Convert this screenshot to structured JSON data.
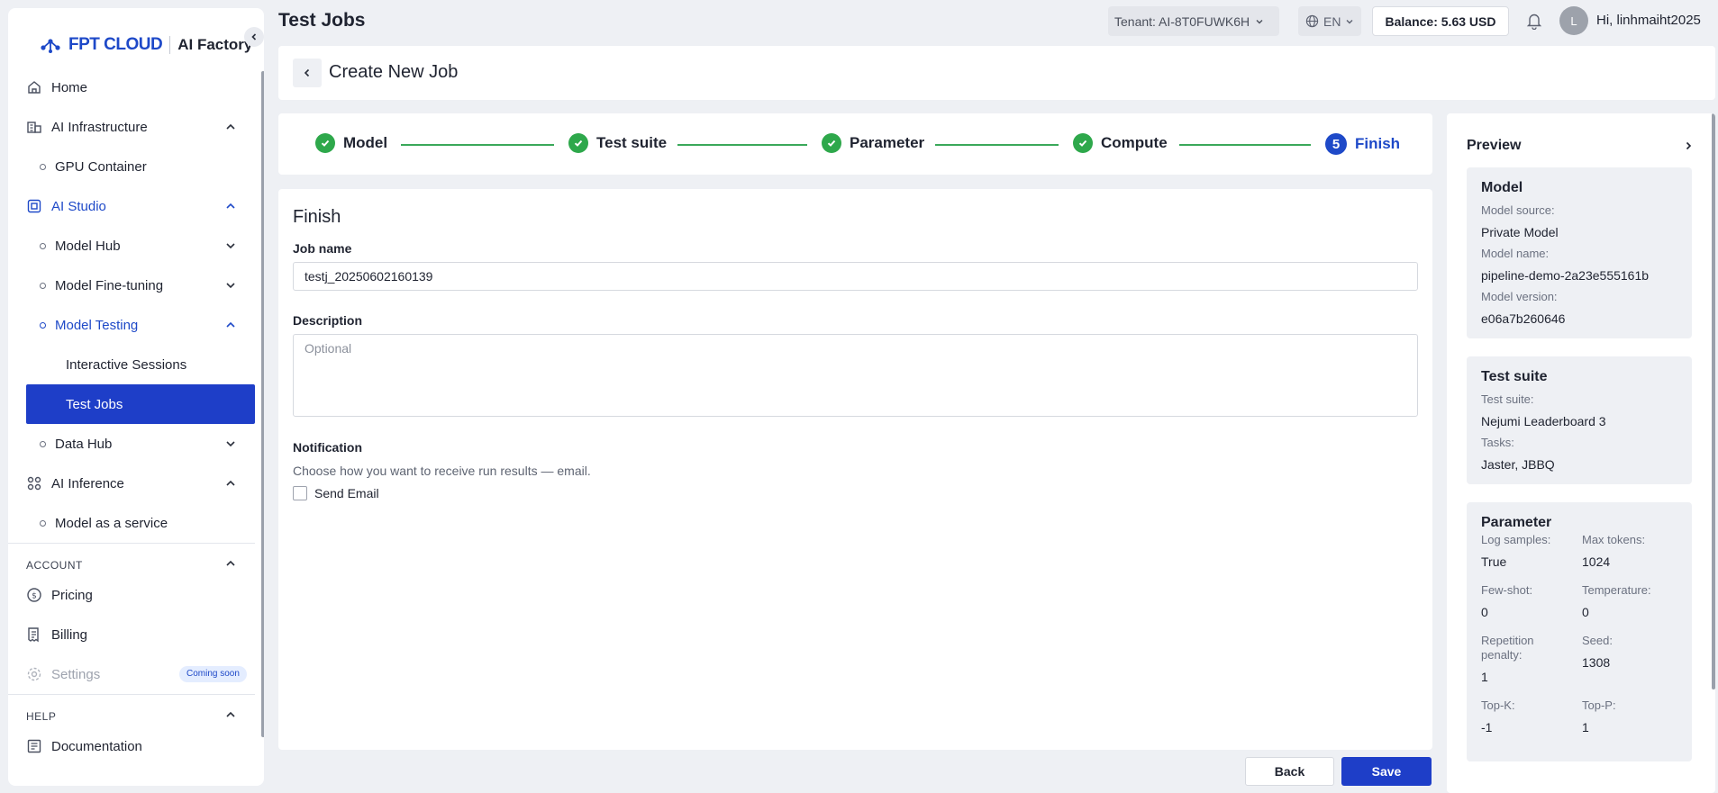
{
  "sidebar": {
    "brand_name": "FPT CLOUD",
    "brand_product": "AI Factory",
    "items": [
      {
        "label": "Home"
      },
      {
        "label": "AI Infrastructure"
      },
      {
        "label": "GPU Container"
      },
      {
        "label": "AI Studio"
      },
      {
        "label": "Model Hub"
      },
      {
        "label": "Model Fine-tuning"
      },
      {
        "label": "Model Testing"
      },
      {
        "label": "Interactive Sessions"
      },
      {
        "label": "Test Jobs"
      },
      {
        "label": "Data Hub"
      },
      {
        "label": "AI Inference"
      },
      {
        "label": "Model as a service"
      }
    ],
    "account_header": "ACCOUNT",
    "account_items": [
      {
        "label": "Pricing"
      },
      {
        "label": "Billing"
      },
      {
        "label": "Settings",
        "badge": "Coming soon"
      }
    ],
    "help_header": "HELP",
    "help_items": [
      {
        "label": "Documentation"
      }
    ]
  },
  "header": {
    "page_title": "Test Jobs",
    "tenant": "Tenant: AI-8T0FUWK6H",
    "language": "EN",
    "balance": "Balance: 5.63 USD",
    "avatar_initial": "L",
    "greeting": "Hi, linhmaiht2025"
  },
  "create": {
    "title": "Create New Job"
  },
  "stepper": {
    "steps": [
      {
        "label": "Model",
        "status": "done"
      },
      {
        "label": "Test suite",
        "status": "done"
      },
      {
        "label": "Parameter",
        "status": "done"
      },
      {
        "label": "Compute",
        "status": "done"
      },
      {
        "label": "Finish",
        "status": "current",
        "number": "5"
      }
    ]
  },
  "form": {
    "title": "Finish",
    "job_name_label": "Job name",
    "job_name_value": "testj_20250602160139",
    "description_label": "Description",
    "description_placeholder": "Optional",
    "notification_label": "Notification",
    "notification_helper": "Choose how you want to receive run results — email.",
    "send_email_label": "Send Email",
    "send_email_checked": false
  },
  "actions": {
    "back_label": "Back",
    "save_label": "Save"
  },
  "preview": {
    "title": "Preview",
    "model": {
      "title": "Model",
      "source_key": "Model source:",
      "source_value": "Private Model",
      "name_key": "Model name:",
      "name_value": "pipeline-demo-2a23e555161b",
      "version_key": "Model version:",
      "version_value": "e06a7b260646"
    },
    "test_suite": {
      "title": "Test suite",
      "suite_key": "Test suite:",
      "suite_value": "Nejumi Leaderboard 3",
      "tasks_key": "Tasks:",
      "tasks_value": "Jaster, JBBQ"
    },
    "parameter": {
      "title": "Parameter",
      "log_samples_key": "Log samples:",
      "log_samples_value": "True",
      "max_tokens_key": "Max tokens:",
      "max_tokens_value": "1024",
      "few_shot_key": "Few-shot:",
      "few_shot_value": "0",
      "temperature_key": "Temperature:",
      "temperature_value": "0",
      "rep_penalty_key": "Repetition penalty:",
      "rep_penalty_value": "1",
      "seed_key": "Seed:",
      "seed_value": "1308",
      "top_k_key": "Top-K:",
      "top_k_value": "-1",
      "top_p_key": "Top-P:",
      "top_p_value": "1"
    }
  },
  "colors": {
    "primary": "#1e3ec8",
    "success": "#2ea84b",
    "background": "#eef0f4"
  }
}
